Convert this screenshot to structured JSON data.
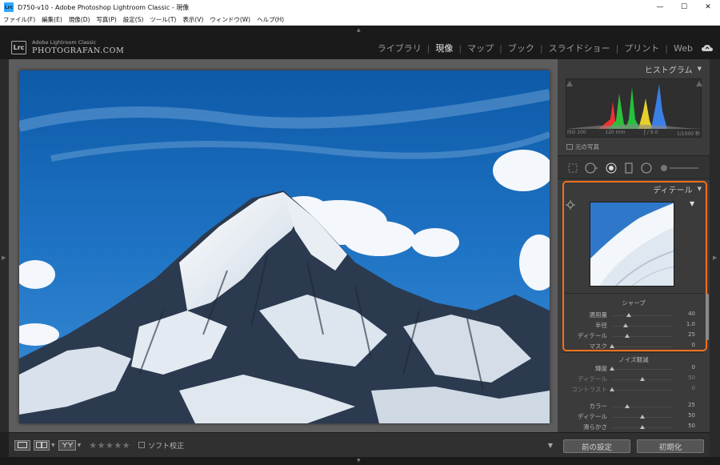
{
  "window": {
    "title": "D750-v10 - Adobe Photoshop Lightroom Classic - 現像",
    "app_icon_text": "Lrc",
    "minimize": "—",
    "maximize": "☐",
    "close": "✕"
  },
  "menu": [
    "ファイル(F)",
    "編集(E)",
    "現像(D)",
    "写真(P)",
    "設定(S)",
    "ツール(T)",
    "表示(V)",
    "ウィンドウ(W)",
    "ヘルプ(H)"
  ],
  "identity": {
    "badge": "Lrc",
    "small": "Adobe Lightroom Classic",
    "brand": "PHOTOGRAFAN.COM"
  },
  "modules": [
    {
      "label": "ライブラリ",
      "active": false
    },
    {
      "label": "現像",
      "active": true
    },
    {
      "label": "マップ",
      "active": false
    },
    {
      "label": "ブック",
      "active": false
    },
    {
      "label": "スライドショー",
      "active": false
    },
    {
      "label": "プリント",
      "active": false
    },
    {
      "label": "Web",
      "active": false
    }
  ],
  "histogram": {
    "title": "ヒストグラム",
    "iso": "ISO 100",
    "focal": "120 mm",
    "aperture": "ƒ / 9.0",
    "shutter": "1/1000 秒",
    "original_label": "元の写真"
  },
  "detail": {
    "title": "ディテール",
    "sharpen_label": "シャープ",
    "sharpen": [
      {
        "label": "適用量",
        "value": "40",
        "fraction": 0.27
      },
      {
        "label": "半径",
        "value": "1.0",
        "fraction": 0.23
      },
      {
        "label": "ディテール",
        "value": "25",
        "fraction": 0.25
      },
      {
        "label": "マスク",
        "value": "0",
        "fraction": 0.0
      }
    ],
    "noise_label": "ノイズ軽減",
    "noise": [
      {
        "label": "輝度",
        "value": "0",
        "fraction": 0.0,
        "dim": false
      },
      {
        "label": "ディテール",
        "value": "50",
        "fraction": 0.5,
        "dim": true
      },
      {
        "label": "コントラスト",
        "value": "0",
        "fraction": 0.0,
        "dim": true
      },
      {
        "label": "カラー",
        "value": "25",
        "fraction": 0.25,
        "dim": false
      },
      {
        "label": "ディテール",
        "value": "50",
        "fraction": 0.5,
        "dim": false
      },
      {
        "label": "滑らかさ",
        "value": "50",
        "fraction": 0.5,
        "dim": false
      }
    ]
  },
  "toolbar": {
    "stars": "★★★★★",
    "soft_proof_label": "ソフト校正"
  },
  "buttons": {
    "previous": "前の設定",
    "reset": "初期化"
  },
  "colors": {
    "accent_highlight": "#f0701a",
    "sky": "#1f6fbf"
  }
}
